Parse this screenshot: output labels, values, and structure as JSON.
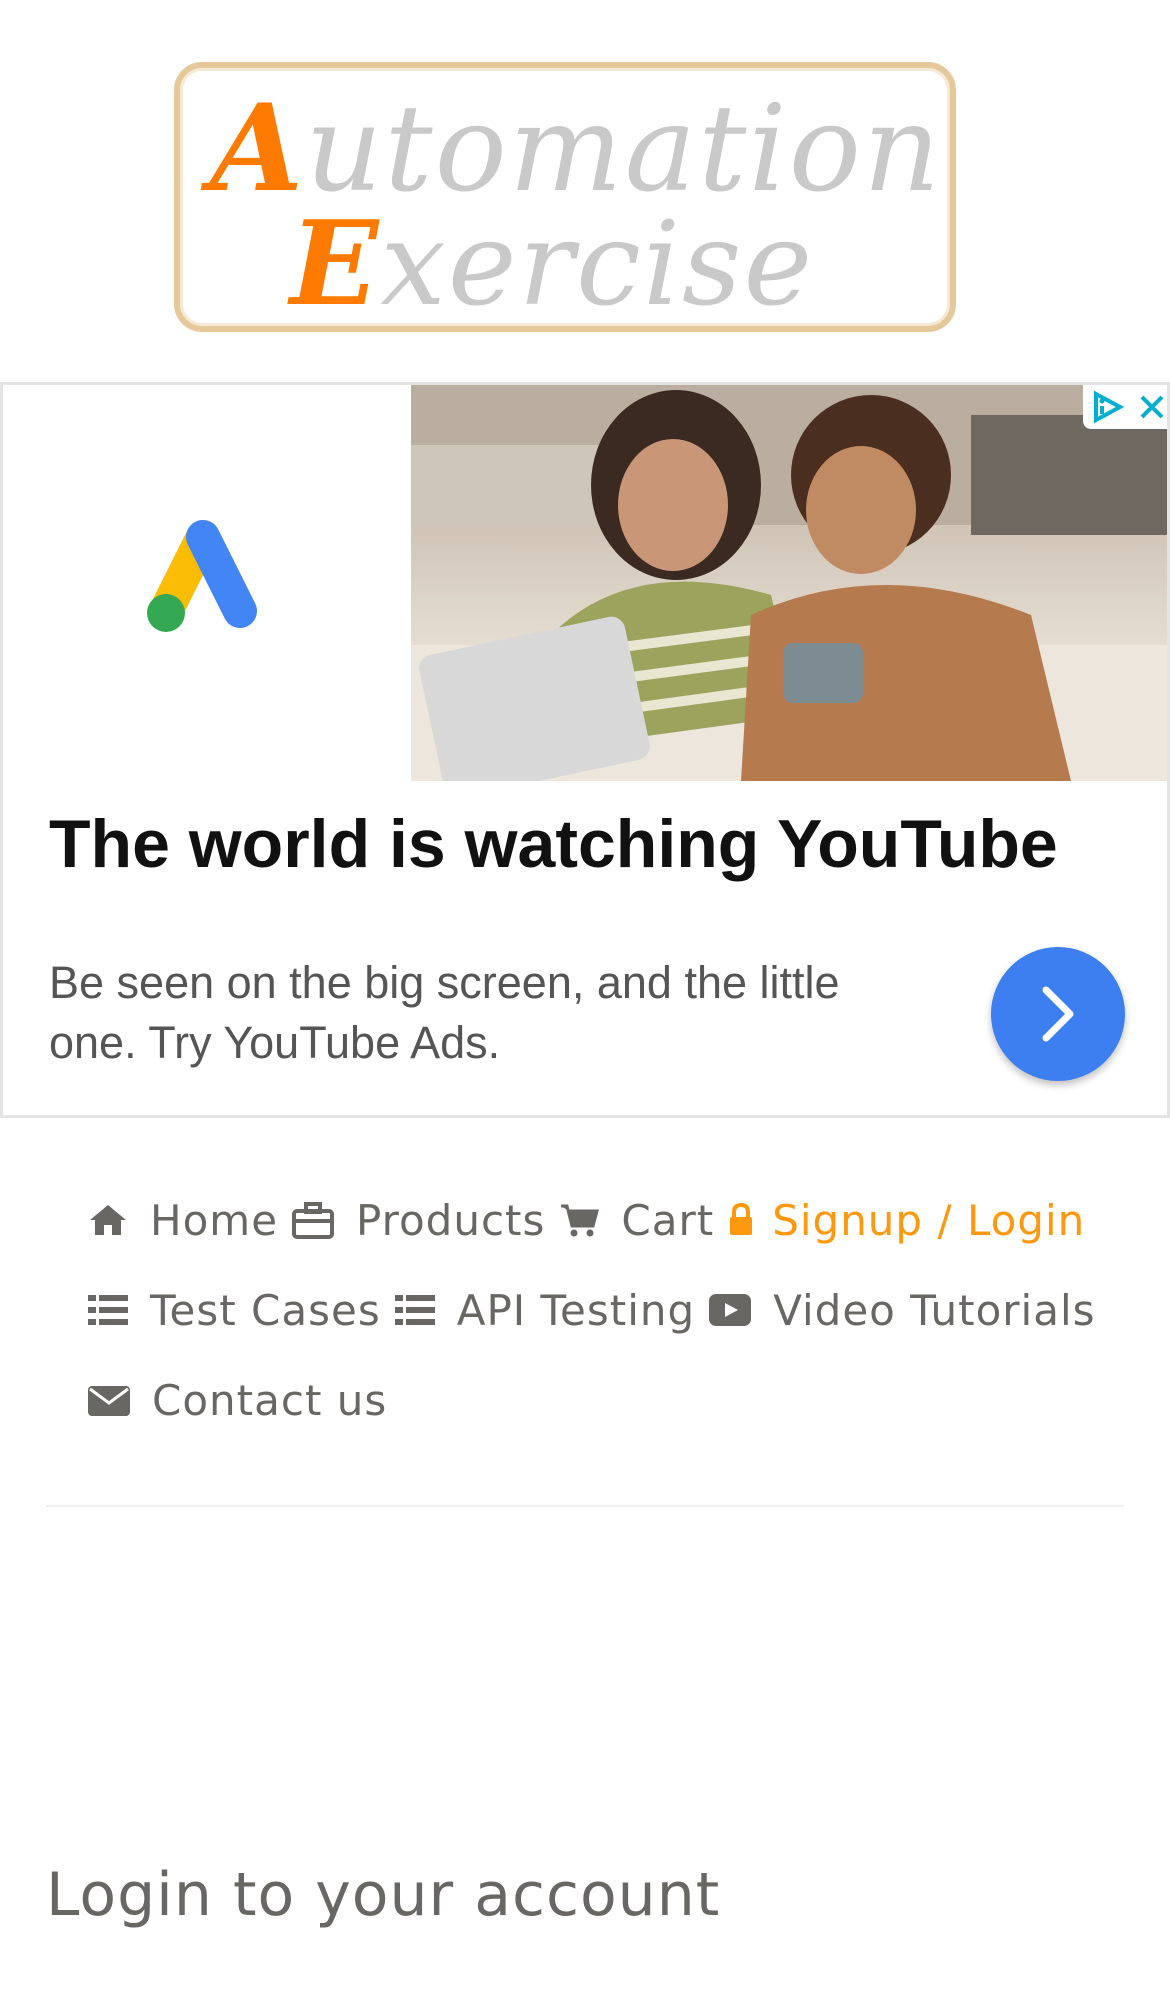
{
  "logo": {
    "line1_first": "A",
    "line1_rest": "utomation",
    "line2_first": "E",
    "line2_rest": "xercise"
  },
  "ad": {
    "title": "The world is watching YouTube",
    "text": "Be seen on the big screen, and the little one. Try YouTube Ads."
  },
  "nav": {
    "home": "Home",
    "products": "Products",
    "cart": "Cart",
    "signup": "Signup / Login",
    "test_cases": "Test Cases",
    "api_testing": "API Testing",
    "video_tutorials": "Video Tutorials",
    "contact": "Contact us"
  },
  "login": {
    "title": "Login to your account"
  },
  "colors": {
    "accent": "#fe980f",
    "text": "#696763",
    "ad_button": "#3d7ff0"
  }
}
